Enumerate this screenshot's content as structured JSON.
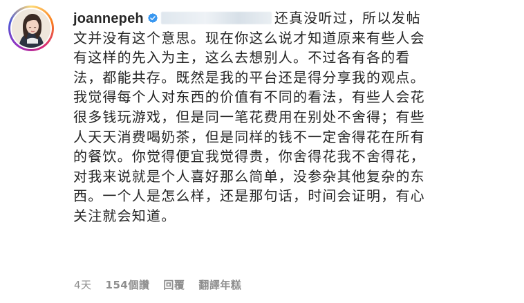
{
  "comment": {
    "username": "joannepeh",
    "verified": true,
    "mention_redacted": true,
    "lines": [
      "还真没听过，所以发帖",
      "文并没有这个意思。现在你这么说才知道原来有些人会",
      "有这样的先入为主，这么去想别人。不过各有各的看",
      "法，都能共存。既然是我的平台还是得分享我的观点。",
      "我觉得每个人对东西的价值有不同的看法，有些人会花",
      "很多钱玩游戏，但是同一笔花费用在别处不舍得；有些",
      "人天天消费喝奶茶，但是同样的钱不一定舍得花在所有",
      "的餐饮。你觉得便宜我觉得贵，你舍得花我不舍得花，",
      "对我来说就是个人喜好那么简单，没参杂其他复杂的东",
      "西。一个人是怎么样，还是那句话，时间会证明，有心",
      "关注就会知道。"
    ]
  },
  "meta": {
    "time": "4天",
    "likes": "154個讚",
    "reply": "回覆",
    "translate": "翻譯年糕"
  },
  "colors": {
    "text": "#262626",
    "muted": "#8e8e8e",
    "verified_blue": "#3897f0"
  },
  "icons": {
    "verified": "verified-badge-icon",
    "avatar": "profile-avatar"
  }
}
